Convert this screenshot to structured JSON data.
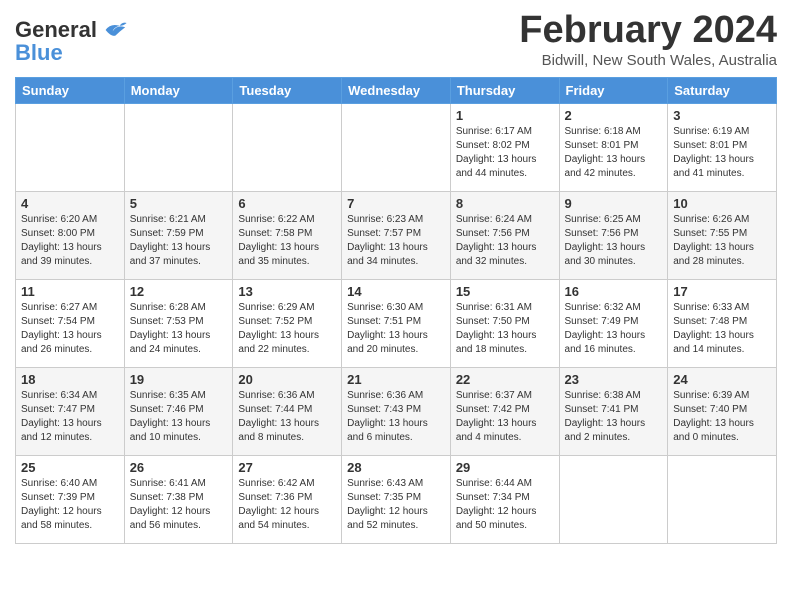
{
  "header": {
    "logo_line1": "General",
    "logo_line2": "Blue",
    "title": "February 2024",
    "subtitle": "Bidwill, New South Wales, Australia"
  },
  "columns": [
    "Sunday",
    "Monday",
    "Tuesday",
    "Wednesday",
    "Thursday",
    "Friday",
    "Saturday"
  ],
  "weeks": [
    {
      "stripe": false,
      "days": [
        {
          "num": "",
          "info": ""
        },
        {
          "num": "",
          "info": ""
        },
        {
          "num": "",
          "info": ""
        },
        {
          "num": "",
          "info": ""
        },
        {
          "num": "1",
          "info": "Sunrise: 6:17 AM\nSunset: 8:02 PM\nDaylight: 13 hours\nand 44 minutes."
        },
        {
          "num": "2",
          "info": "Sunrise: 6:18 AM\nSunset: 8:01 PM\nDaylight: 13 hours\nand 42 minutes."
        },
        {
          "num": "3",
          "info": "Sunrise: 6:19 AM\nSunset: 8:01 PM\nDaylight: 13 hours\nand 41 minutes."
        }
      ]
    },
    {
      "stripe": true,
      "days": [
        {
          "num": "4",
          "info": "Sunrise: 6:20 AM\nSunset: 8:00 PM\nDaylight: 13 hours\nand 39 minutes."
        },
        {
          "num": "5",
          "info": "Sunrise: 6:21 AM\nSunset: 7:59 PM\nDaylight: 13 hours\nand 37 minutes."
        },
        {
          "num": "6",
          "info": "Sunrise: 6:22 AM\nSunset: 7:58 PM\nDaylight: 13 hours\nand 35 minutes."
        },
        {
          "num": "7",
          "info": "Sunrise: 6:23 AM\nSunset: 7:57 PM\nDaylight: 13 hours\nand 34 minutes."
        },
        {
          "num": "8",
          "info": "Sunrise: 6:24 AM\nSunset: 7:56 PM\nDaylight: 13 hours\nand 32 minutes."
        },
        {
          "num": "9",
          "info": "Sunrise: 6:25 AM\nSunset: 7:56 PM\nDaylight: 13 hours\nand 30 minutes."
        },
        {
          "num": "10",
          "info": "Sunrise: 6:26 AM\nSunset: 7:55 PM\nDaylight: 13 hours\nand 28 minutes."
        }
      ]
    },
    {
      "stripe": false,
      "days": [
        {
          "num": "11",
          "info": "Sunrise: 6:27 AM\nSunset: 7:54 PM\nDaylight: 13 hours\nand 26 minutes."
        },
        {
          "num": "12",
          "info": "Sunrise: 6:28 AM\nSunset: 7:53 PM\nDaylight: 13 hours\nand 24 minutes."
        },
        {
          "num": "13",
          "info": "Sunrise: 6:29 AM\nSunset: 7:52 PM\nDaylight: 13 hours\nand 22 minutes."
        },
        {
          "num": "14",
          "info": "Sunrise: 6:30 AM\nSunset: 7:51 PM\nDaylight: 13 hours\nand 20 minutes."
        },
        {
          "num": "15",
          "info": "Sunrise: 6:31 AM\nSunset: 7:50 PM\nDaylight: 13 hours\nand 18 minutes."
        },
        {
          "num": "16",
          "info": "Sunrise: 6:32 AM\nSunset: 7:49 PM\nDaylight: 13 hours\nand 16 minutes."
        },
        {
          "num": "17",
          "info": "Sunrise: 6:33 AM\nSunset: 7:48 PM\nDaylight: 13 hours\nand 14 minutes."
        }
      ]
    },
    {
      "stripe": true,
      "days": [
        {
          "num": "18",
          "info": "Sunrise: 6:34 AM\nSunset: 7:47 PM\nDaylight: 13 hours\nand 12 minutes."
        },
        {
          "num": "19",
          "info": "Sunrise: 6:35 AM\nSunset: 7:46 PM\nDaylight: 13 hours\nand 10 minutes."
        },
        {
          "num": "20",
          "info": "Sunrise: 6:36 AM\nSunset: 7:44 PM\nDaylight: 13 hours\nand 8 minutes."
        },
        {
          "num": "21",
          "info": "Sunrise: 6:36 AM\nSunset: 7:43 PM\nDaylight: 13 hours\nand 6 minutes."
        },
        {
          "num": "22",
          "info": "Sunrise: 6:37 AM\nSunset: 7:42 PM\nDaylight: 13 hours\nand 4 minutes."
        },
        {
          "num": "23",
          "info": "Sunrise: 6:38 AM\nSunset: 7:41 PM\nDaylight: 13 hours\nand 2 minutes."
        },
        {
          "num": "24",
          "info": "Sunrise: 6:39 AM\nSunset: 7:40 PM\nDaylight: 13 hours\nand 0 minutes."
        }
      ]
    },
    {
      "stripe": false,
      "days": [
        {
          "num": "25",
          "info": "Sunrise: 6:40 AM\nSunset: 7:39 PM\nDaylight: 12 hours\nand 58 minutes."
        },
        {
          "num": "26",
          "info": "Sunrise: 6:41 AM\nSunset: 7:38 PM\nDaylight: 12 hours\nand 56 minutes."
        },
        {
          "num": "27",
          "info": "Sunrise: 6:42 AM\nSunset: 7:36 PM\nDaylight: 12 hours\nand 54 minutes."
        },
        {
          "num": "28",
          "info": "Sunrise: 6:43 AM\nSunset: 7:35 PM\nDaylight: 12 hours\nand 52 minutes."
        },
        {
          "num": "29",
          "info": "Sunrise: 6:44 AM\nSunset: 7:34 PM\nDaylight: 12 hours\nand 50 minutes."
        },
        {
          "num": "",
          "info": ""
        },
        {
          "num": "",
          "info": ""
        }
      ]
    }
  ]
}
